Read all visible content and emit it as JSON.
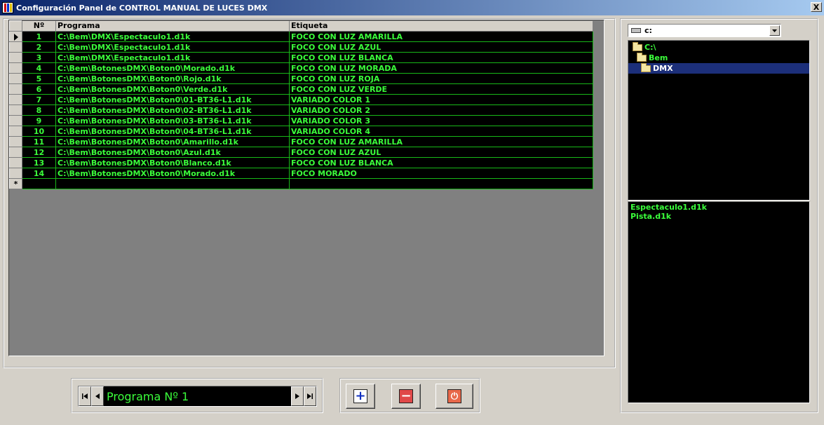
{
  "window": {
    "title": "Configuración Panel de CONTROL MANUAL DE LUCES DMX",
    "close_label": "X"
  },
  "grid": {
    "columns": [
      "Nº",
      "Programa",
      "Etiqueta"
    ],
    "rows": [
      {
        "num": "1",
        "programa": "C:\\Bem\\DMX\\Espectaculo1.d1k",
        "etiqueta": "FOCO CON LUZ AMARILLA"
      },
      {
        "num": "2",
        "programa": "C:\\Bem\\DMX\\Espectaculo1.d1k",
        "etiqueta": "FOCO CON LUZ AZUL"
      },
      {
        "num": "3",
        "programa": "C:\\Bem\\DMX\\Espectaculo1.d1k",
        "etiqueta": "FOCO CON LUZ BLANCA"
      },
      {
        "num": "4",
        "programa": "C:\\Bem\\BotonesDMX\\Boton0\\Morado.d1k",
        "etiqueta": "FOCO CON LUZ MORADA"
      },
      {
        "num": "5",
        "programa": "C:\\Bem\\BotonesDMX\\Boton0\\Rojo.d1k",
        "etiqueta": "FOCO CON LUZ ROJA"
      },
      {
        "num": "6",
        "programa": "C:\\Bem\\BotonesDMX\\Boton0\\Verde.d1k",
        "etiqueta": "FOCO CON LUZ VERDE"
      },
      {
        "num": "7",
        "programa": "C:\\Bem\\BotonesDMX\\Boton0\\01-BT36-L1.d1k",
        "etiqueta": "VARIADO COLOR 1"
      },
      {
        "num": "8",
        "programa": "C:\\Bem\\BotonesDMX\\Boton0\\02-BT36-L1.d1k",
        "etiqueta": "VARIADO COLOR 2"
      },
      {
        "num": "9",
        "programa": "C:\\Bem\\BotonesDMX\\Boton0\\03-BT36-L1.d1k",
        "etiqueta": "VARIADO COLOR 3"
      },
      {
        "num": "10",
        "programa": "C:\\Bem\\BotonesDMX\\Boton0\\04-BT36-L1.d1k",
        "etiqueta": "VARIADO COLOR 4"
      },
      {
        "num": "11",
        "programa": "C:\\Bem\\BotonesDMX\\Boton0\\Amarillo.d1k",
        "etiqueta": "FOCO CON LUZ AMARILLA"
      },
      {
        "num": "12",
        "programa": "C:\\Bem\\BotonesDMX\\Boton0\\Azul.d1k",
        "etiqueta": "FOCO CON LUZ AZUL"
      },
      {
        "num": "13",
        "programa": "C:\\Bem\\BotonesDMX\\Boton0\\Blanco.d1k",
        "etiqueta": "FOCO CON LUZ BLANCA"
      },
      {
        "num": "14",
        "programa": "C:\\Bem\\BotonesDMX\\Boton0\\Morado.d1k",
        "etiqueta": "FOCO MORADO"
      }
    ],
    "new_row_marker": "*"
  },
  "navigator": {
    "current_text": "Programa Nº 1",
    "first_icon": "first-record-icon",
    "prev_icon": "prev-record-icon",
    "next_icon": "next-record-icon",
    "last_icon": "last-record-icon"
  },
  "actions": {
    "add_icon": "plus-icon",
    "remove_icon": "minus-icon",
    "exit_icon": "power-icon",
    "add_glyph": "+",
    "remove_glyph": "−",
    "exit_glyph": "⏻"
  },
  "drive": {
    "selected": "c:"
  },
  "directories": [
    {
      "label": "C:\\",
      "selected": false,
      "indent": 0
    },
    {
      "label": "Bem",
      "selected": false,
      "indent": 1
    },
    {
      "label": "DMX",
      "selected": true,
      "indent": 2
    }
  ],
  "files": [
    "Espectaculo1.d1k",
    "Pista.d1k"
  ],
  "colors": {
    "grid_text": "#3bff3b",
    "grid_bg": "#000000",
    "grid_line": "#18b818",
    "selection": "#1c2f7a",
    "titlebar_start": "#0a246a",
    "titlebar_end": "#a6caf0",
    "window_bg": "#d4d0c8"
  }
}
